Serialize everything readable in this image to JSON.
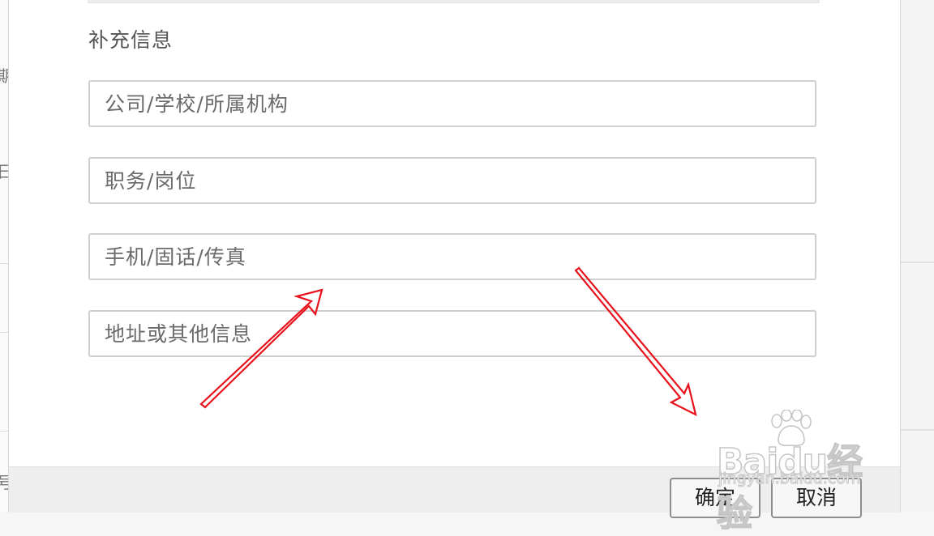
{
  "background": {
    "left_fragments": [
      "期",
      "日",
      "号"
    ]
  },
  "dialog": {
    "section_title": "补充信息",
    "fields": [
      {
        "placeholder": "公司/学校/所属机构",
        "value": ""
      },
      {
        "placeholder": "职务/岗位",
        "value": ""
      },
      {
        "placeholder": "手机/固话/传真",
        "value": ""
      },
      {
        "placeholder": "地址或其他信息",
        "value": ""
      }
    ],
    "buttons": {
      "confirm": "确定",
      "cancel": "取消"
    }
  },
  "watermark": {
    "brand": "Baidu经验",
    "url": "jingyan.baidu.com"
  },
  "colors": {
    "annotation_arrow": "#e8101a",
    "field_border": "#cfcfcf",
    "footer_bg": "#eeeeee"
  }
}
